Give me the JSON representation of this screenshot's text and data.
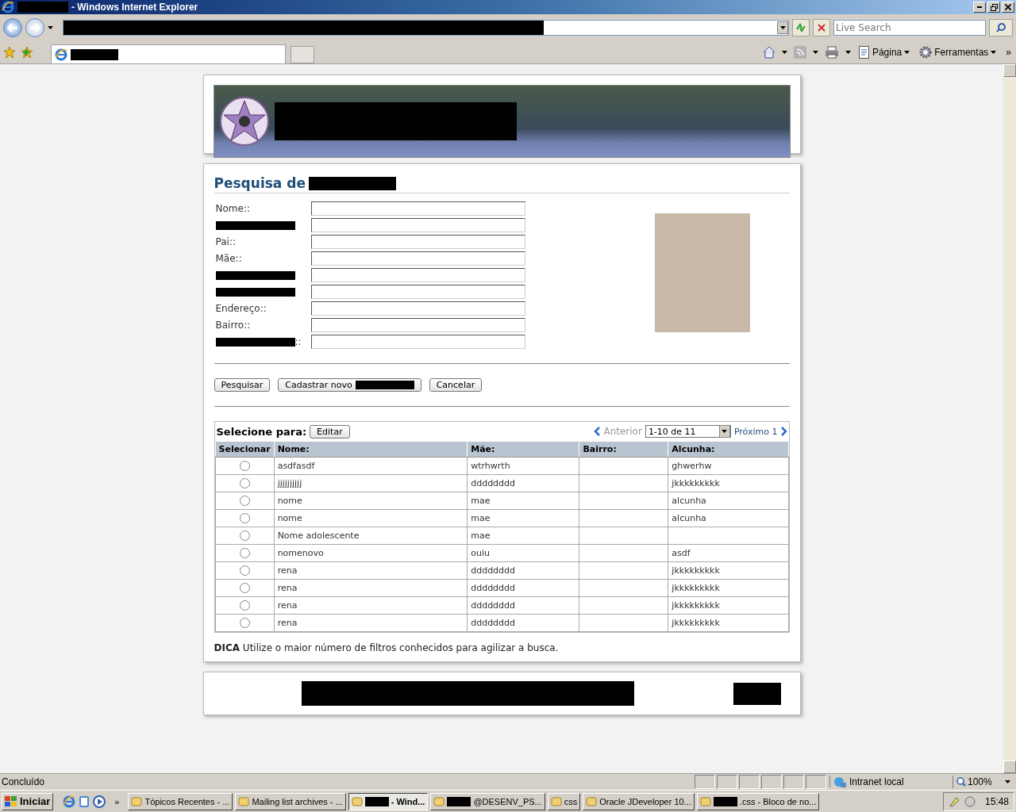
{
  "window": {
    "title": "- Windows Internet Explorer"
  },
  "toolbar": {
    "search_placeholder": "Live Search",
    "commands": [
      "Página",
      "Ferramentas"
    ],
    "overflow": "»"
  },
  "form": {
    "title": "Pesquisa de",
    "fields": [
      {
        "kind": "text",
        "label": "Nome::"
      },
      {
        "kind": "redacted"
      },
      {
        "kind": "text",
        "label": "Pai::"
      },
      {
        "kind": "text",
        "label": "Mãe::"
      },
      {
        "kind": "redacted"
      },
      {
        "kind": "redacted"
      },
      {
        "kind": "text",
        "label": "Endereço::"
      },
      {
        "kind": "text",
        "label": "Bairro::"
      },
      {
        "kind": "redacted",
        "label": "::"
      }
    ],
    "buttons": [
      {
        "label": "Pesquisar",
        "redacted": false
      },
      {
        "label": "Cadastrar novo",
        "redacted": true
      },
      {
        "label": "Cancelar",
        "redacted": false
      }
    ]
  },
  "results": {
    "select_label": "Selecione para:",
    "edit_button": "Editar",
    "previous": {
      "label": "Anterior",
      "disabled": true
    },
    "page_select": "1-10 de 11",
    "next": {
      "label": "Próximo 1",
      "disabled": false
    },
    "columns": [
      "Selecionar",
      "Nome:",
      "Mãe:",
      "Bairro:",
      "Alcunha:"
    ],
    "rows": [
      {
        "selected": false,
        "cells": [
          "",
          "asdfasdf",
          "wtrhwrth",
          "",
          "ghwerhw"
        ]
      },
      {
        "selected": false,
        "cells": [
          "",
          "jjjjjjjjjj",
          "dddddddd",
          "",
          "jkkkkkkkkk"
        ]
      },
      {
        "selected": false,
        "cells": [
          "",
          "nome",
          "mae",
          "",
          "alcunha"
        ]
      },
      {
        "selected": false,
        "cells": [
          "",
          "nome",
          "mae",
          "",
          "alcunha"
        ]
      },
      {
        "selected": false,
        "cells": [
          "",
          "Nome adolescente",
          "mae",
          "",
          ""
        ]
      },
      {
        "selected": false,
        "cells": [
          "",
          "nomenovo",
          "ouiu",
          "",
          "asdf"
        ]
      },
      {
        "selected": false,
        "cells": [
          "",
          "rena",
          "dddddddd",
          "",
          "jkkkkkkkkk"
        ]
      },
      {
        "selected": false,
        "cells": [
          "",
          "rena",
          "dddddddd",
          "",
          "jkkkkkkkkk"
        ]
      },
      {
        "selected": false,
        "cells": [
          "",
          "rena",
          "dddddddd",
          "",
          "jkkkkkkkkk"
        ]
      },
      {
        "selected": false,
        "cells": [
          "",
          "rena",
          "dddddddd",
          "",
          "jkkkkkkkkk"
        ]
      }
    ]
  },
  "tip": "**DICA** Utilize o maior número de filtros conhecidos para agilizar a busca.",
  "status_bar": {
    "text": "Concluído",
    "zone": "Intranet local",
    "zoom": "100%"
  },
  "taskbar": {
    "start": "Iniciar",
    "overflow": "»",
    "tasks": [
      {
        "label": "Tópicos Recentes - ...",
        "redacted": false,
        "active": false
      },
      {
        "label": "Mailing list archives - ...",
        "redacted": false,
        "active": false
      },
      {
        "label": "- Wind...",
        "redacted": true,
        "active": true
      },
      {
        "label": "@DESENV_PS...",
        "redacted": true,
        "active": false
      },
      {
        "label": "css",
        "redacted": false,
        "active": false
      },
      {
        "label": "Oracle JDeveloper 10...",
        "redacted": false,
        "active": false
      },
      {
        "label": ".css - Bloco de no...",
        "redacted": true,
        "active": false
      }
    ],
    "clock": "15:48"
  }
}
